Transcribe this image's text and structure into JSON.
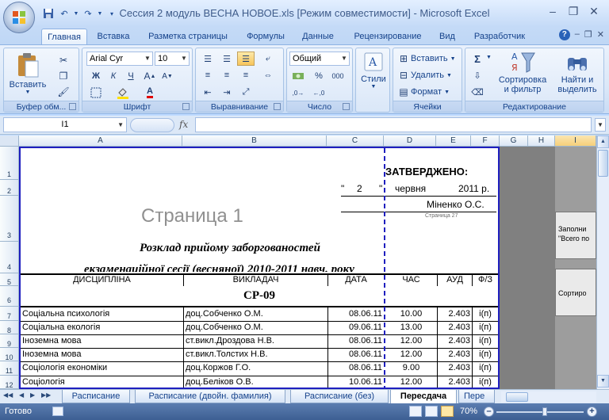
{
  "window": {
    "title": "Сессия 2 модуль ВЕСНА НОВОЕ.xls  [Режим совместимости] - Microsoft Excel"
  },
  "tabs": [
    {
      "label": "Главная",
      "active": true
    },
    {
      "label": "Вставка"
    },
    {
      "label": "Разметка страницы"
    },
    {
      "label": "Формулы"
    },
    {
      "label": "Данные"
    },
    {
      "label": "Рецензирование"
    },
    {
      "label": "Вид"
    },
    {
      "label": "Разработчик"
    }
  ],
  "ribbon": {
    "clipboard": {
      "label": "Буфер обм...",
      "paste": "Вставить"
    },
    "font": {
      "label": "Шрифт",
      "name": "Arial Cyr",
      "size": "10",
      "bold": "Ж",
      "italic": "К",
      "underline": "Ч"
    },
    "align": {
      "label": "Выравнивание"
    },
    "number": {
      "label": "Число",
      "format": "Общий",
      "percent": "%",
      "thousands": "000"
    },
    "styles": {
      "label": "Стили"
    },
    "cells": {
      "label": "Ячейки",
      "insert": "Вставить",
      "delete": "Удалить",
      "format": "Формат"
    },
    "editing": {
      "label": "Редактирование",
      "sum": "Σ",
      "sort1": "Сортировка",
      "sort2": "и фильтр",
      "find1": "Найти и",
      "find2": "выделить"
    }
  },
  "formula_bar": {
    "name_box": "I1",
    "fx": "fx",
    "value": ""
  },
  "columns": [
    "A",
    "B",
    "C",
    "D",
    "E",
    "F",
    "G",
    "H",
    "I"
  ],
  "rows": [
    "1",
    "2",
    "3",
    "4",
    "5",
    "6",
    "7",
    "8",
    "9",
    "10",
    "11",
    "12"
  ],
  "sheet": {
    "approved": "ЗАТВЕРДЖЕНО:",
    "date_q1": "\"",
    "date_day": "2",
    "date_q2": "\"",
    "date_month": "червня",
    "date_year": "2011 р.",
    "signer": "Міненко О.С.",
    "page_label_small": "Страница 27",
    "watermark": "Страница 1",
    "heading1": "Розклад  прийому заборгованостей",
    "heading2": "екзаменаційної сесії (весняної) 2010-2011 навч. року",
    "headers": {
      "discipline": "ДИСЦИПЛІНА",
      "teacher": "ВИКЛАДАЧ",
      "date": "ДАТА",
      "time": "ЧАС",
      "room": "АУД",
      "form": "Ф/З"
    },
    "group": "СР-09",
    "records": [
      {
        "discipline": "Соціальна психологія",
        "teacher": "доц.Собченко О.М.",
        "date": "08.06.11",
        "time": "10.00",
        "room": "2.403",
        "form": "і(п)"
      },
      {
        "discipline": "Соціальна екологія",
        "teacher": "доц.Собченко О.М.",
        "date": "09.06.11",
        "time": "13.00",
        "room": "2.403",
        "form": "і(п)"
      },
      {
        "discipline": "Іноземна мова",
        "teacher": "ст.викл.Дроздова Н.В.",
        "date": "08.06.11",
        "time": "12.00",
        "room": "2.403",
        "form": "і(п)"
      },
      {
        "discipline": "Іноземна мова",
        "teacher": "ст.викл.Толстих Н.В.",
        "date": "08.06.11",
        "time": "12.00",
        "room": "2.403",
        "form": "і(п)"
      },
      {
        "discipline": "Соціологія економіки",
        "teacher": "доц.Коржов Г.О.",
        "date": "08.06.11",
        "time": "9.00",
        "room": "2.403",
        "form": "і(п)"
      },
      {
        "discipline": "Соціологія",
        "teacher": "доц.Беліков О.В.",
        "date": "10.06.11",
        "time": "12.00",
        "room": "2.403",
        "form": "і(п)"
      }
    ]
  },
  "side_buttons": {
    "fill": "Заполни",
    "fill2": "\"Всего по",
    "sort": "Сортиро"
  },
  "sheet_tabs": [
    {
      "label": "Расписание"
    },
    {
      "label": "Расписание (двойн. фамилия)"
    },
    {
      "label": "Расписание (без)"
    },
    {
      "label": "Пересдача",
      "active": true
    },
    {
      "label": "Пере"
    }
  ],
  "status": {
    "text": "Готово",
    "zoom": "70%"
  }
}
